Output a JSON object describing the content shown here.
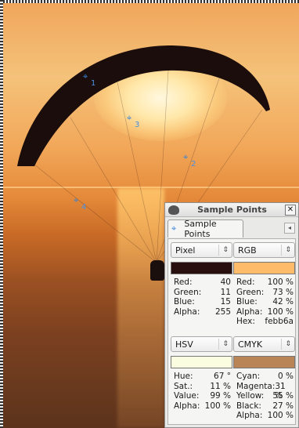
{
  "canvas": {
    "markers": [
      {
        "label": "1"
      },
      {
        "label": "3"
      },
      {
        "label": "2"
      },
      {
        "label": "4"
      }
    ]
  },
  "dialog": {
    "title": "Sample Points",
    "tab_label": "Sample Points",
    "close_glyph": "✕",
    "menu_glyph": "◂",
    "left_top": {
      "mode": "Pixel",
      "swatch_color": "#28100f",
      "rows": [
        {
          "label": "Red:",
          "value": "40"
        },
        {
          "label": "Green:",
          "value": "11"
        },
        {
          "label": "Blue:",
          "value": "15"
        },
        {
          "label": "Alpha:",
          "value": "255"
        }
      ]
    },
    "right_top": {
      "mode": "RGB",
      "swatch_color": "#febb6a",
      "rows": [
        {
          "label": "Red:",
          "value": "100 %"
        },
        {
          "label": "Green:",
          "value": "73 %"
        },
        {
          "label": "Blue:",
          "value": "42 %"
        },
        {
          "label": "Alpha:",
          "value": "100 %"
        },
        {
          "label": "Hex:",
          "value": "febb6a"
        }
      ]
    },
    "left_bottom": {
      "mode": "HSV",
      "swatch_color": "#fbfde0",
      "rows": [
        {
          "label": "Hue:",
          "value": "67 °"
        },
        {
          "label": "Sat.:",
          "value": "11 %"
        },
        {
          "label": "Value:",
          "value": "99 %"
        },
        {
          "label": "Alpha:",
          "value": "100 %"
        }
      ]
    },
    "right_bottom": {
      "mode": "CMYK",
      "swatch_color": "#b98456",
      "rows": [
        {
          "label": "Cyan:",
          "value": "0 %"
        },
        {
          "label": "Magenta:",
          "value": "31 %"
        },
        {
          "label": "Yellow:",
          "value": "55 %"
        },
        {
          "label": "Black:",
          "value": "27 %"
        },
        {
          "label": "Alpha:",
          "value": "100 %"
        }
      ]
    }
  }
}
